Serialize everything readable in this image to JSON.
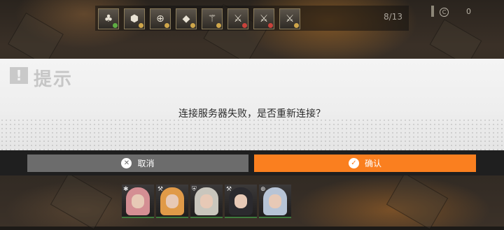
{
  "top_bar": {
    "slots": [
      {
        "icon": "plant-icon",
        "glyph": "♣",
        "mini": "#5fae43"
      },
      {
        "icon": "hexagon-icon",
        "glyph": "⬢",
        "mini": "#cfa64a"
      },
      {
        "icon": "crosshair-icon",
        "glyph": "⊕",
        "mini": "#cfa64a"
      },
      {
        "icon": "diamond-icon",
        "glyph": "◆",
        "mini": "#cfa64a"
      },
      {
        "icon": "wand-icon",
        "glyph": "⚚",
        "mini": "#cfa64a"
      },
      {
        "icon": "crossed-swords-icon",
        "glyph": "⚔",
        "mini": "#c9433b"
      },
      {
        "icon": "crossed-swords-icon",
        "glyph": "⚔",
        "mini": "#c9433b"
      },
      {
        "icon": "crossed-swords-icon",
        "glyph": "⚔",
        "mini": "#cfa64a"
      }
    ],
    "counter": "8/13",
    "resource_value": "0"
  },
  "dialog": {
    "title": "提示",
    "message": "连接服务器失败，是否重新连接？",
    "cancel_label": "取消",
    "confirm_label": "确认"
  },
  "team": [
    {
      "name": "portrait-1",
      "class_glyph": "✱",
      "hair": "#d48e93"
    },
    {
      "name": "portrait-2",
      "class_glyph": "⚒",
      "hair": "#e09a48"
    },
    {
      "name": "portrait-3",
      "class_glyph": "⛨",
      "hair": "#c9c6bd"
    },
    {
      "name": "portrait-4",
      "class_glyph": "⚒",
      "hair": "#2b2a2e"
    },
    {
      "name": "portrait-5",
      "class_glyph": "⊕",
      "hair": "#b7c4d6"
    }
  ],
  "colors": {
    "confirm": "#fa7f1f",
    "cancel": "#6c6c6c"
  }
}
